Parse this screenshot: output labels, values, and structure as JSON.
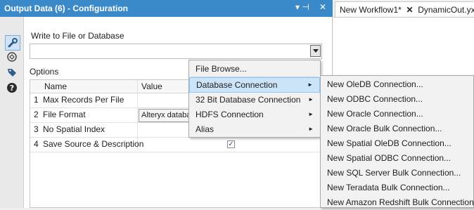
{
  "panel": {
    "title": "Output Data (6) - Configuration",
    "pin_glyph": "▾ ⊣",
    "close_glyph": "✕",
    "write_label": "Write to File or Database",
    "write_value": "",
    "options_label": "Options",
    "table": {
      "headers": [
        "Name",
        "Value"
      ],
      "rows": [
        {
          "num": "1",
          "name": "Max Records Per File",
          "value": ""
        },
        {
          "num": "2",
          "name": "File Format",
          "value": "Alteryx database"
        },
        {
          "num": "3",
          "name": "No Spatial Index",
          "value": ""
        },
        {
          "num": "4",
          "name": "Save Source & Description",
          "value": "✓"
        }
      ]
    },
    "tools": [
      "wrench-icon",
      "tool-connection-icon",
      "tag-icon",
      "help-icon"
    ]
  },
  "tabs": [
    {
      "label": "New Workflow1*",
      "close": "✕"
    },
    {
      "label": "DynamicOut.yxmd"
    }
  ],
  "menu": {
    "items": [
      {
        "label": "File Browse...",
        "submenu": false
      },
      {
        "label": "Database Connection",
        "submenu": true,
        "highlighted": true
      },
      {
        "label": "32 Bit Database Connection",
        "submenu": true
      },
      {
        "label": "HDFS Connection",
        "submenu": true
      },
      {
        "label": "Alias",
        "submenu": true
      }
    ],
    "submenu_arrow": "►"
  },
  "submenu": {
    "items": [
      "New OleDB Connection...",
      "New ODBC Connection...",
      "New Oracle Connection...",
      "New Oracle Bulk Connection...",
      "New Spatial OleDB Connection...",
      "New Spatial ODBC Connection...",
      "New SQL Server Bulk Connection...",
      "New Teradata Bulk Connection...",
      "New Amazon Redshift Bulk Connection..."
    ]
  },
  "colors": {
    "titlebar": "#3a8ac9",
    "highlight": "#cce4f7"
  }
}
